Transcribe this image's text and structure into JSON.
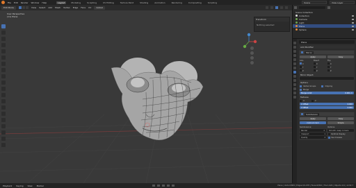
{
  "topbar": {
    "menu": [
      "File",
      "Edit",
      "Render",
      "Window",
      "Help"
    ],
    "workspaces": [
      "Layout",
      "Modeling",
      "Sculpting",
      "UV Editing",
      "Texture Paint",
      "Shading",
      "Animation",
      "Rendering",
      "Compositing",
      "Scripting"
    ],
    "active_workspace": "Layout",
    "scene": "Scene",
    "view_layer": "View Layer"
  },
  "viewport_header": {
    "mode": "Edit Mode",
    "menus": [
      "View",
      "Select",
      "Add",
      "Mesh",
      "Vertex",
      "Edge",
      "Face",
      "UV"
    ],
    "orientation": "Global"
  },
  "viewport": {
    "view_name": "User Perspective",
    "object_name": "(11) Plane",
    "n_panel_title": "Transform",
    "n_panel_text": "Nothing selected"
  },
  "outliner": {
    "title": "Scene Collection",
    "rows": [
      {
        "label": "Collection",
        "selected": false
      },
      {
        "label": "Camera",
        "selected": false
      },
      {
        "label": "Light",
        "selected": false
      },
      {
        "label": "Plane",
        "selected": true
      },
      {
        "label": "Sphere",
        "selected": false
      }
    ]
  },
  "properties": {
    "object": "Plane",
    "add_modifier": "Add Modifier",
    "mirror": {
      "name": "Mirror",
      "apply": "Apply",
      "copy": "Copy",
      "axis": "Axis",
      "bisect": "Bisect",
      "flip": "Flip",
      "x": "X",
      "y": "Y",
      "z": "Z",
      "mirror_object": "Mirror Object:",
      "options": "Options",
      "vertex_groups": "Vertex Groups",
      "clipping": "Clipping",
      "merge": "Merge",
      "merge_limit": "Merge Limit",
      "merge_value": "0.001 m",
      "textures": "Textures",
      "u": "U",
      "v": "V",
      "u_offset_label": "U Offset",
      "u_offset": "0.000",
      "v_offset_label": "V Offset",
      "v_offset": "0.000"
    },
    "subsurf": {
      "name": "Subdivision",
      "apply": "Apply",
      "copy": "Copy",
      "catmull": "Catmull-Clark",
      "simple": "Simple",
      "subdivisions": "Subdivisions:",
      "options": "Options:",
      "render_label": "Render",
      "render_val": "2",
      "viewport_label": "Viewport",
      "viewport_val": "1",
      "quality_label": "Quality",
      "quality_val": "3",
      "smooth": "Smooth, keep corners",
      "optimal": "Optimal Display",
      "creases": "Use Creases"
    }
  },
  "statusbar": {
    "items": [
      "Playback",
      "Keying",
      "View",
      "Marker"
    ],
    "stats": "Plane | Verts:0/869 | Edges:0/1,678 | Faces:0/810 | Tris:1,620 | Objects:1/4 | v2.82.7"
  }
}
